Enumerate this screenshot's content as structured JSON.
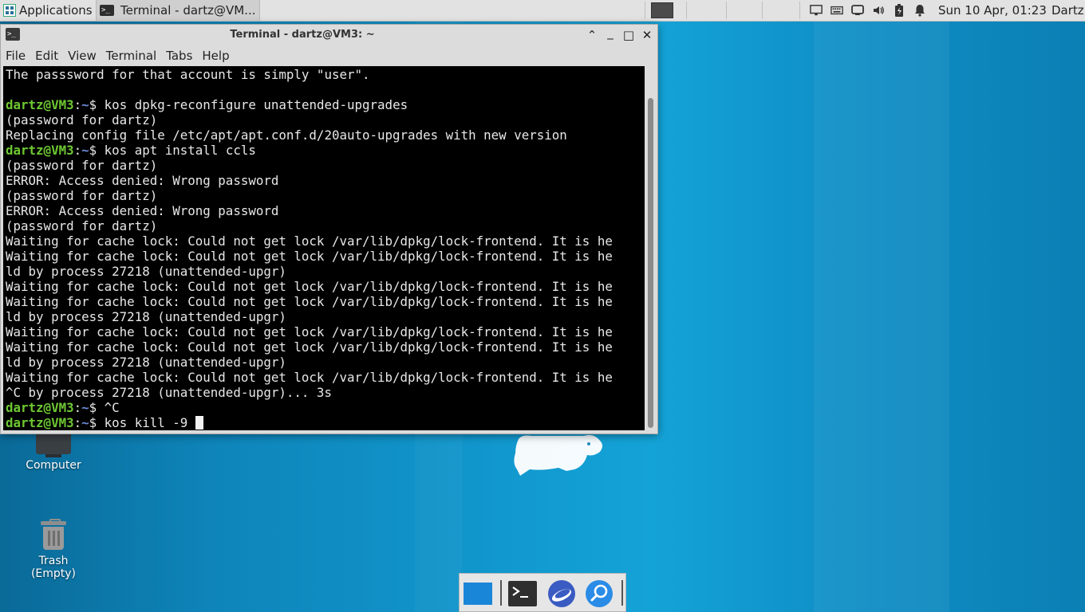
{
  "top_panel": {
    "applications_label": "Applications",
    "task_terminal_label": "Terminal - dartz@VM...",
    "task_terminal_icon": ">_",
    "clock": "Sun 10 Apr, 01:23",
    "user": "Dartz"
  },
  "window": {
    "title": "Terminal - dartz@VM3: ~",
    "icon_text": ">_",
    "controls": {
      "shade": "⌃",
      "minimize": "_",
      "maximize": "□",
      "close": "✕"
    },
    "menu": [
      "File",
      "Edit",
      "View",
      "Terminal",
      "Tabs",
      "Help"
    ]
  },
  "terminal": {
    "prompt_user": "dartz@VM3",
    "prompt_sep": ":",
    "prompt_path": "~",
    "prompt_sym": "$ ",
    "lines": [
      {
        "text": "The passsword for that account is simply \"user\"."
      },
      {
        "text": ""
      },
      {
        "prompt": true,
        "text": "kos dpkg-reconfigure unattended-upgrades"
      },
      {
        "text": "(password for dartz)"
      },
      {
        "text": "Replacing config file /etc/apt/apt.conf.d/20auto-upgrades with new version"
      },
      {
        "prompt": true,
        "text": "kos apt install ccls"
      },
      {
        "text": "(password for dartz)"
      },
      {
        "text": "ERROR: Access denied: Wrong password"
      },
      {
        "text": "(password for dartz)"
      },
      {
        "text": "ERROR: Access denied: Wrong password"
      },
      {
        "text": "(password for dartz)"
      },
      {
        "text": "Waiting for cache lock: Could not get lock /var/lib/dpkg/lock-frontend. It is he"
      },
      {
        "text": "Waiting for cache lock: Could not get lock /var/lib/dpkg/lock-frontend. It is he"
      },
      {
        "text": "ld by process 27218 (unattended-upgr)"
      },
      {
        "text": "Waiting for cache lock: Could not get lock /var/lib/dpkg/lock-frontend. It is he"
      },
      {
        "text": "Waiting for cache lock: Could not get lock /var/lib/dpkg/lock-frontend. It is he"
      },
      {
        "text": "ld by process 27218 (unattended-upgr)"
      },
      {
        "text": "Waiting for cache lock: Could not get lock /var/lib/dpkg/lock-frontend. It is he"
      },
      {
        "text": "Waiting for cache lock: Could not get lock /var/lib/dpkg/lock-frontend. It is he"
      },
      {
        "text": "ld by process 27218 (unattended-upgr)"
      },
      {
        "text": "Waiting for cache lock: Could not get lock /var/lib/dpkg/lock-frontend. It is he"
      },
      {
        "text": "^C by process 27218 (unattended-upgr)... 3s"
      },
      {
        "prompt": true,
        "text": "^C"
      },
      {
        "prompt": true,
        "text": "kos kill -9 ",
        "cursor": true
      }
    ]
  },
  "desktop": {
    "computer_label": "Computer",
    "trash_label_1": "Trash",
    "trash_label_2": "(Empty)"
  },
  "colors": {
    "prompt_user": "#6ec832",
    "prompt_path": "#6b8bd6",
    "desktop_blue": "#1197cd"
  }
}
